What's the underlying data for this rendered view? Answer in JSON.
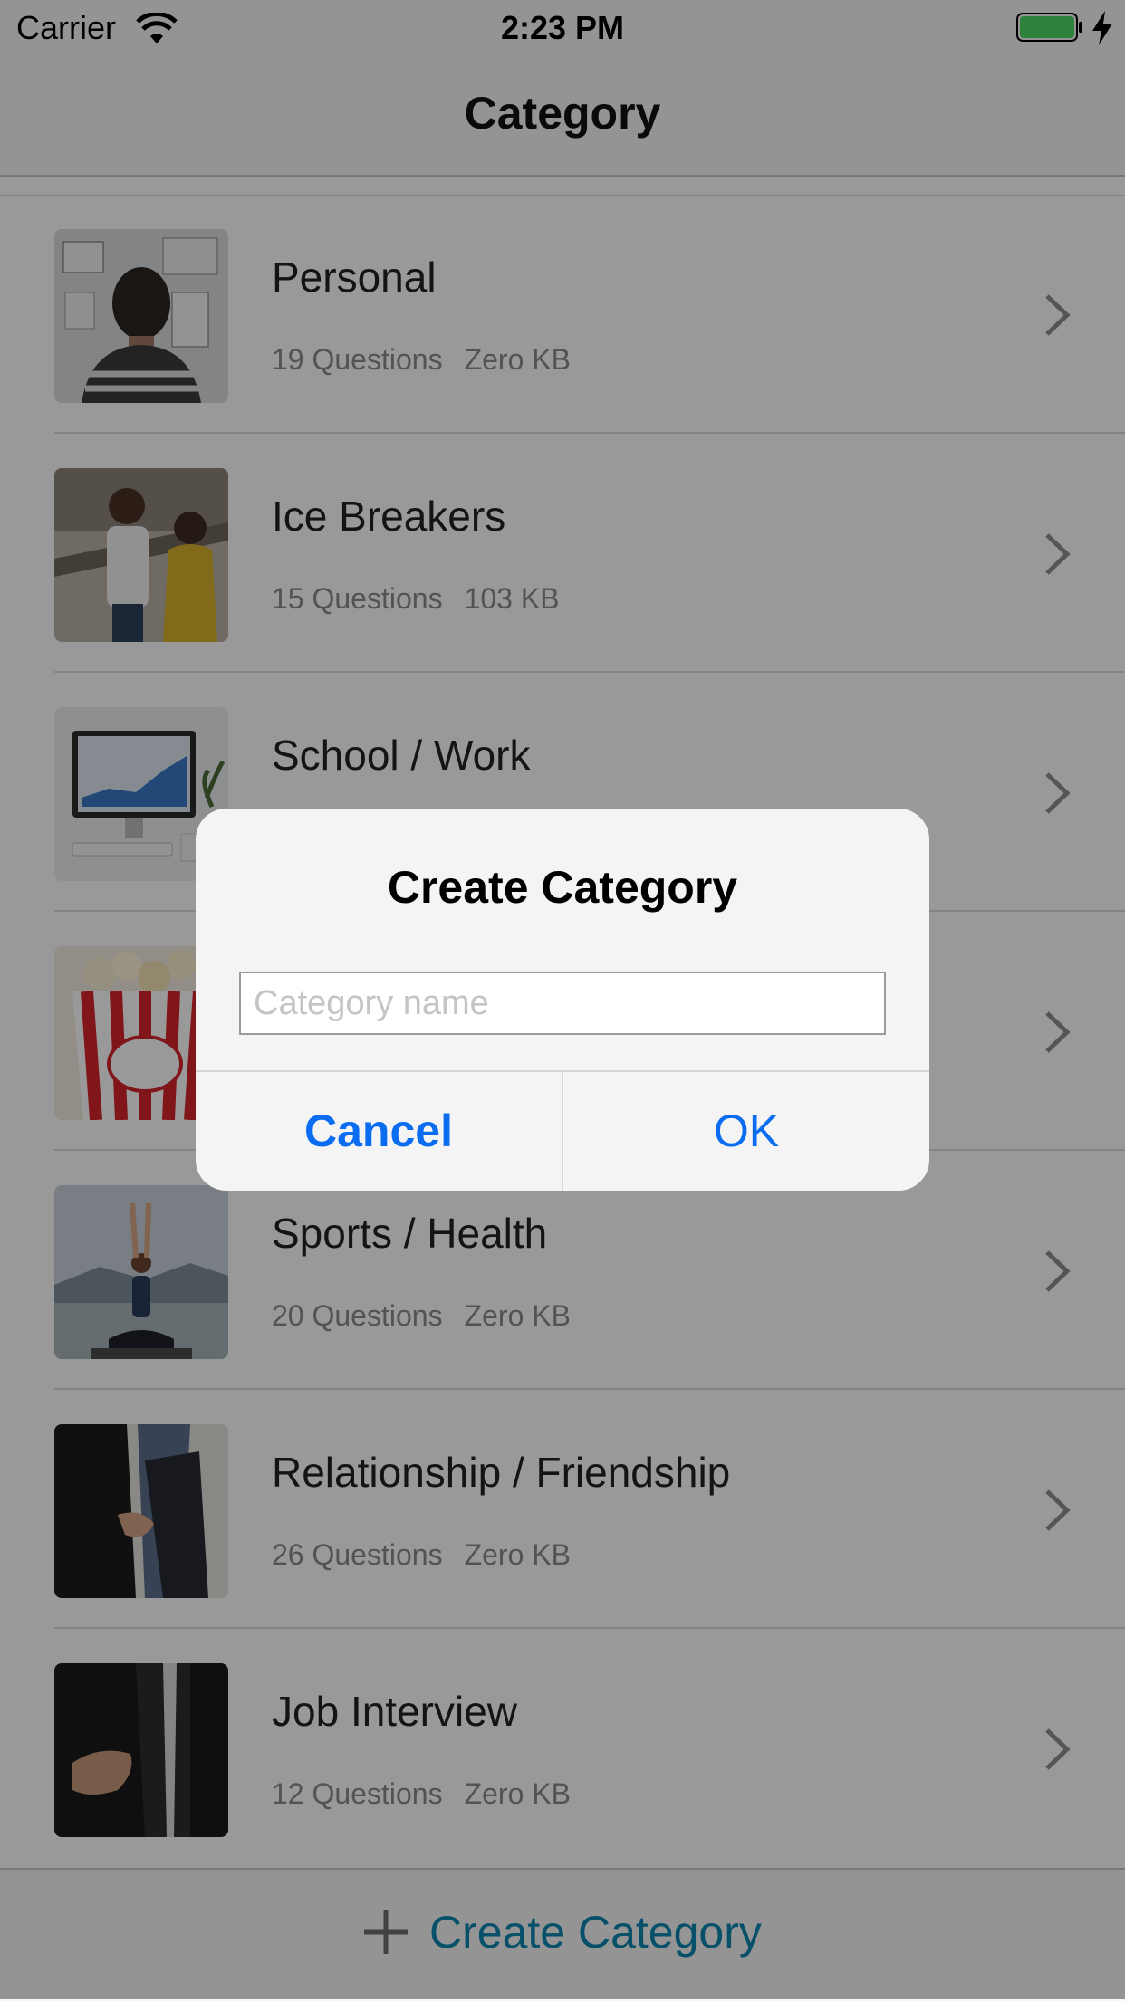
{
  "status_bar": {
    "carrier": "Carrier",
    "time": "2:23 PM",
    "battery_level": 1.0
  },
  "nav": {
    "title": "Category"
  },
  "categories": [
    {
      "title": "Personal",
      "questions": "19 Questions",
      "size": "Zero KB",
      "image": "man-in-front-of-board-photo"
    },
    {
      "title": "Ice Breakers",
      "questions": "15 Questions",
      "size": "103 KB",
      "image": "two-people-talking-photo"
    },
    {
      "title": "School / Work",
      "questions": "",
      "size": "",
      "image": "desktop-computer-photo"
    },
    {
      "title": "",
      "questions": "",
      "size": "",
      "image": "popcorn-box-photo"
    },
    {
      "title": "Sports / Health",
      "questions": "20 Questions",
      "size": "Zero KB",
      "image": "woman-meditating-photo"
    },
    {
      "title": "Relationship / Friendship",
      "questions": "26 Questions",
      "size": "Zero KB",
      "image": "couple-holding-hands-photo"
    },
    {
      "title": "Job Interview",
      "questions": "12 Questions",
      "size": "Zero KB",
      "image": "handshake-photo"
    }
  ],
  "toolbar": {
    "create_label": "Create Category"
  },
  "alert": {
    "title": "Create Category",
    "input_placeholder": "Category name",
    "input_value": "",
    "cancel_label": "Cancel",
    "ok_label": "OK"
  },
  "colors": {
    "accent": "#0a6cf0",
    "toolbar_accent": "#0a85b0",
    "battery": "#4cd964"
  }
}
